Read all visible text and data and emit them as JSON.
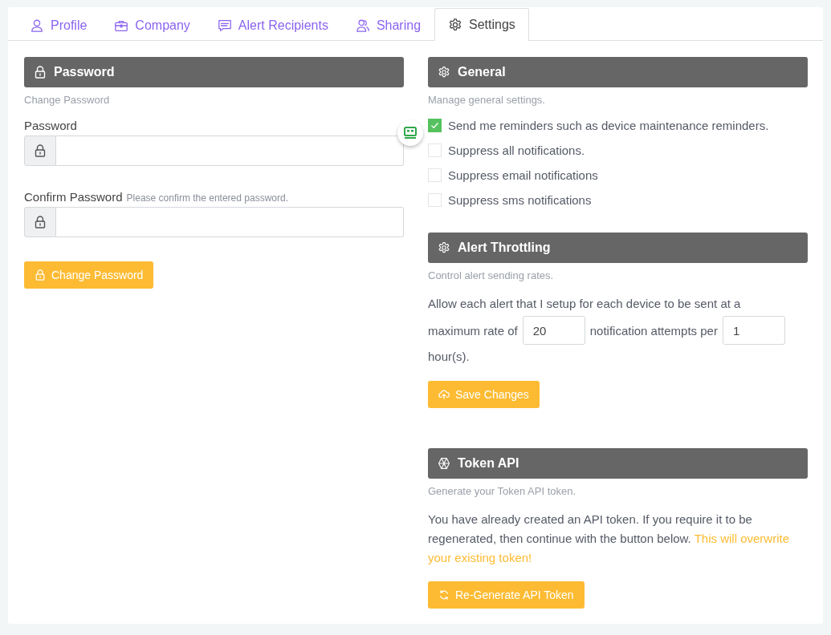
{
  "tabs": [
    {
      "label": "Profile",
      "selected": false
    },
    {
      "label": "Company",
      "selected": false
    },
    {
      "label": "Alert Recipients",
      "selected": false
    },
    {
      "label": "Sharing",
      "selected": false
    },
    {
      "label": "Settings",
      "selected": true
    }
  ],
  "password_section": {
    "title": "Password",
    "subtitle": "Change Password",
    "fields": [
      {
        "label": "Password"
      },
      {
        "label": "Confirm Password",
        "hint": "Please confirm the entered password."
      }
    ],
    "button": "Change Password"
  },
  "general_section": {
    "title": "General",
    "subtitle": "Manage general settings.",
    "options": [
      {
        "label": "Send me reminders such as device maintenance reminders.",
        "checked": true
      },
      {
        "label": "Suppress all notifications.",
        "checked": false
      },
      {
        "label": "Suppress email notifications",
        "checked": false
      },
      {
        "label": "Suppress sms notifications",
        "checked": false
      }
    ]
  },
  "throttling_section": {
    "title": "Alert Throttling",
    "subtitle": "Control alert sending rates.",
    "text_before": "Allow each alert that I setup for each device to be sent at a",
    "rate_label": "maximum rate of",
    "attempts": "20",
    "text_middle": "notification attempts per",
    "hours": "1",
    "text_after": "hour(s).",
    "button": "Save Changes"
  },
  "token_section": {
    "title": "Token API",
    "subtitle": "Generate your Token API token.",
    "text": "You have already created an API token. If you require it to be regenerated, then continue with the button below.",
    "warning": "This will overwrite your existing token!",
    "button": "Re-Generate API Token"
  }
}
